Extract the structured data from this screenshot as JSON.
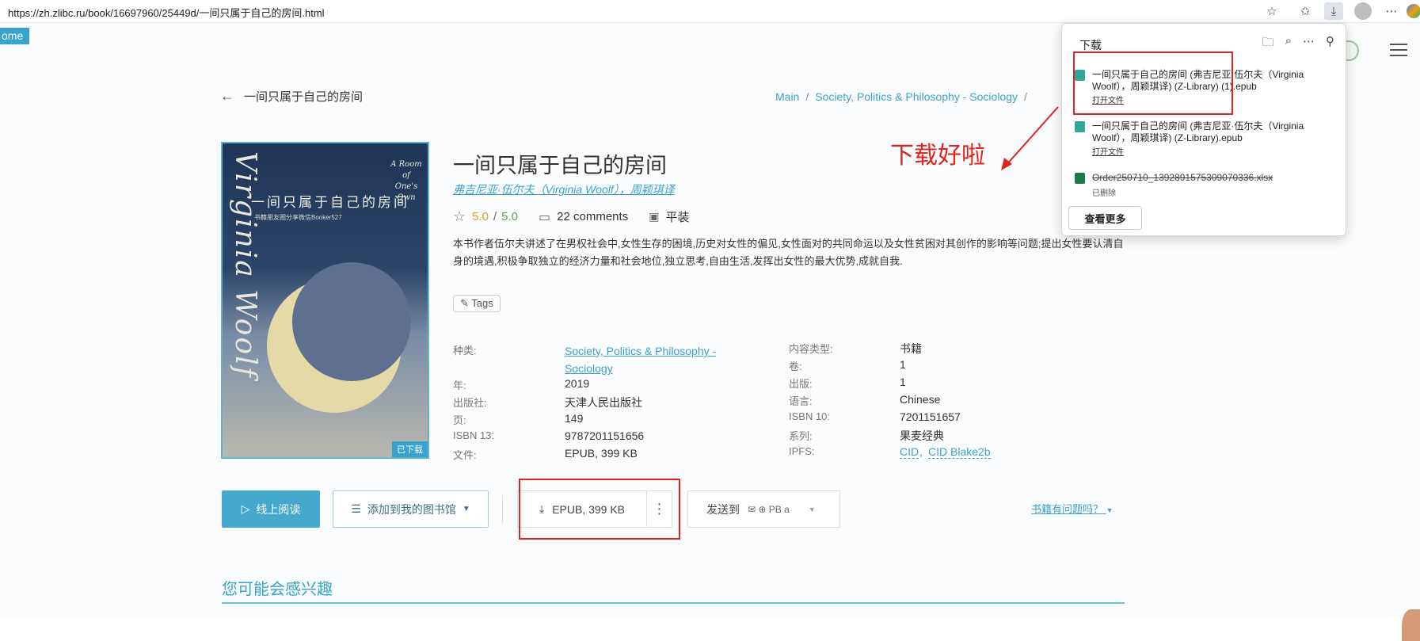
{
  "browser": {
    "url": "https://zh.zlibc.ru/book/16697960/25449d/一间只属于自己的房间.html",
    "toolbar_icons": [
      "star-outline-icon",
      "favorites-icon",
      "download-icon",
      "profile-icon",
      "more-icon",
      "copilot-icon"
    ]
  },
  "site": {
    "home_label": "ome"
  },
  "nav": {
    "back_title": "一间只属于自己的房间",
    "breadcrumb": [
      "Main",
      "Society, Politics & Philosophy - Sociology",
      "/"
    ]
  },
  "cover": {
    "vertical_title": "Virginia Woolf",
    "cn_title": "一间只属于自己的房间",
    "subtitle": "书籍朋友圈分享微信Booker527",
    "en_title": "A Room of One's Own",
    "downloaded_tag": "已下载"
  },
  "book": {
    "title": "一间只属于自己的房间",
    "author": "弗吉尼亚·伍尔夫（Virginia Woolf），周颖琪译",
    "rating": "5.0",
    "rating_max": "5.0",
    "comments": "22 comments",
    "binding": "平装",
    "description": "本书作者伍尔夫讲述了在男权社会中,女性生存的困境,历史对女性的偏见,女性面对的共同命运以及女性贫困对其创作的影响等问题;提出女性要认清自身的境遇,积极争取独立的经济力量和社会地位,独立思考,自由生活,发挥出女性的最大优势,成就自我.",
    "tags_label": "Tags"
  },
  "details_left": [
    {
      "label": "种类:",
      "value": "Society, Politics & Philosophy - Sociology",
      "link": true
    },
    {
      "label": "年:",
      "value": "2019"
    },
    {
      "label": "出版社:",
      "value": "天津人民出版社"
    },
    {
      "label": "页:",
      "value": "149"
    },
    {
      "label": "ISBN 13:",
      "value": "9787201151656"
    },
    {
      "label": "文件:",
      "value": "EPUB, 399 KB"
    }
  ],
  "details_right": [
    {
      "label": "内容类型:",
      "value": "书籍"
    },
    {
      "label": "卷:",
      "value": "1"
    },
    {
      "label": "出版:",
      "value": "1"
    },
    {
      "label": "语言:",
      "value": "Chinese"
    },
    {
      "label": "ISBN 10:",
      "value": "7201151657"
    },
    {
      "label": "系列:",
      "value": "果麦经典"
    },
    {
      "label": "IPFS:",
      "value_a": "CID",
      "value_b": "CID Blake2b"
    }
  ],
  "actions": {
    "read_online": "线上阅读",
    "add_shelf": "添加到我的图书馆",
    "download": "EPUB, 399 KB",
    "send_to": "发送到",
    "send_icons": "✉ ⊕ PB a",
    "problem": "书籍有问题吗？"
  },
  "section": {
    "interest": "您可能会感兴趣"
  },
  "annotation": {
    "text": "下载好啦"
  },
  "downloads_panel": {
    "header": "下载",
    "items": [
      {
        "name": "一间只属于自己的房间 (弗吉尼亚·伍尔夫（Virginia Woolf），周颖琪译) (Z-Library) (1).epub",
        "action": "打开文件",
        "deleted": false,
        "type": "epub"
      },
      {
        "name": "一间只属于自己的房间 (弗吉尼亚·伍尔夫（Virginia Woolf），周颖琪译) (Z-Library).epub",
        "action": "打开文件",
        "deleted": false,
        "type": "epub"
      },
      {
        "name": "Order250710_1392891575309070336.xlsx",
        "action": "已删除",
        "deleted": true,
        "type": "xlsx"
      }
    ],
    "see_more": "查看更多"
  },
  "colors": {
    "accent": "#3aa3c9",
    "annotation_red": "#e0241b",
    "rating_gold": "#e0a316",
    "rating_green": "#5aa84f"
  }
}
